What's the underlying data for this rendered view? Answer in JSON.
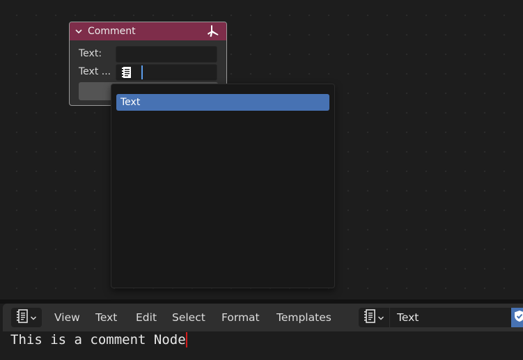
{
  "node": {
    "title": "Comment",
    "header_color": "#7e2d4a",
    "text_label": "Text:",
    "text_block_label": "Text ...",
    "collapse_icon": "chevron-down-icon",
    "tool_icon": "wrench-icon"
  },
  "dropdown": {
    "items": [
      {
        "label": "Text",
        "selected": true
      }
    ],
    "highlight_color": "#4772b3"
  },
  "text_editor": {
    "editor_type_icon": "text-editor-icon",
    "menu": [
      "View",
      "Text",
      "Edit",
      "Select",
      "Format",
      "Templates"
    ],
    "text_block_name": "Text",
    "fake_user_icon": "shield-check-icon",
    "content": "This is a comment Node"
  }
}
